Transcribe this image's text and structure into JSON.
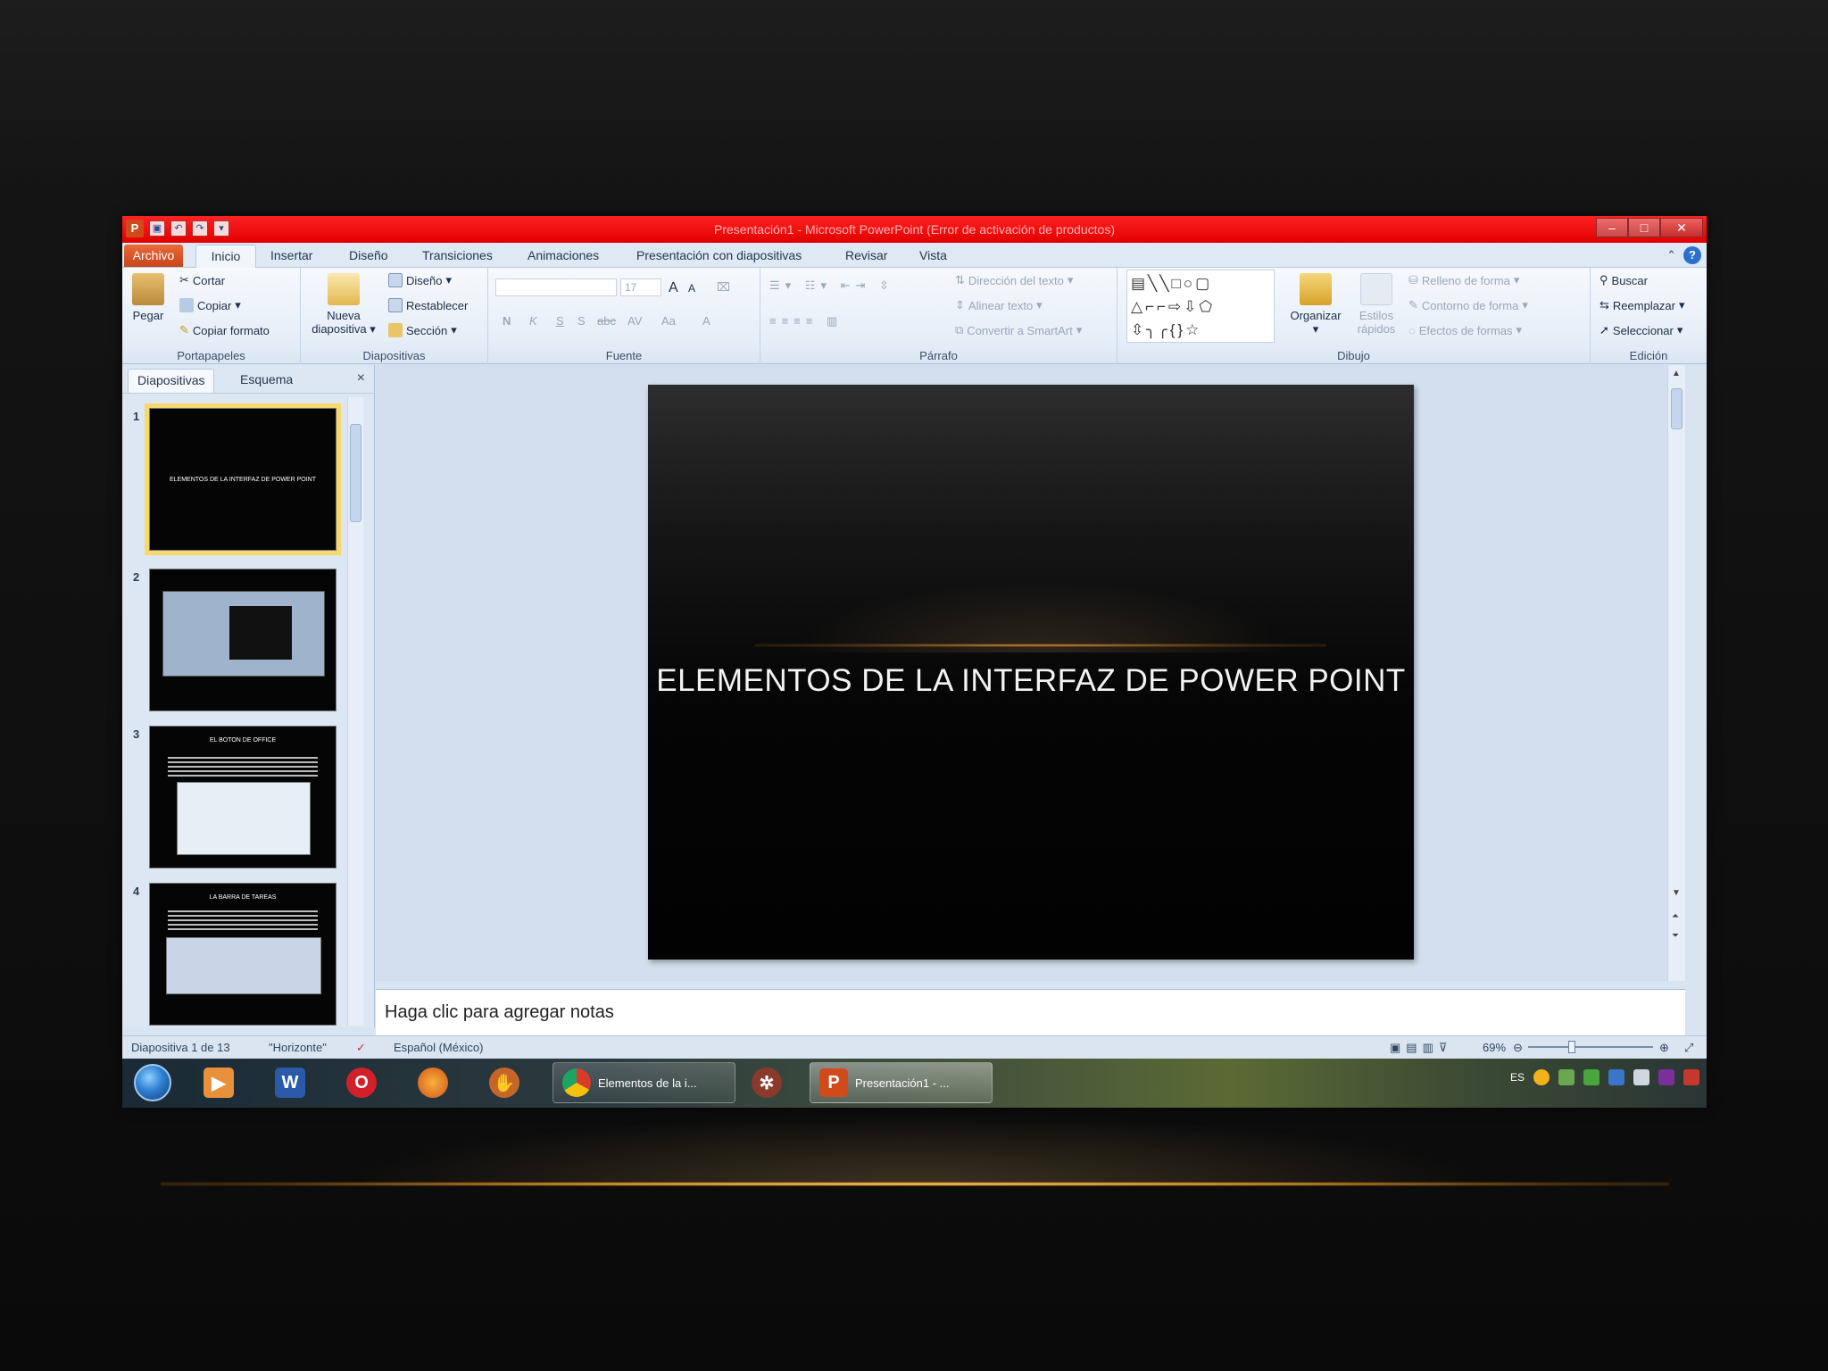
{
  "window": {
    "title": "Presentación1 - Microsoft PowerPoint (Error de activación de productos)",
    "logo": "P",
    "controls": {
      "minimize": "–",
      "maximize": "□",
      "close": "✕"
    }
  },
  "tabs": {
    "file": "Archivo",
    "items": [
      "Inicio",
      "Insertar",
      "Diseño",
      "Transiciones",
      "Animaciones",
      "Presentación con diapositivas",
      "Revisar",
      "Vista"
    ]
  },
  "ribbon": {
    "clipboard": {
      "paste": "Pegar",
      "cut": "Cortar",
      "copy": "Copiar",
      "format_painter": "Copiar formato",
      "label": "Portapapeles"
    },
    "slides": {
      "new_slide_line1": "Nueva",
      "new_slide_line2": "diapositiva",
      "layout": "Diseño",
      "reset": "Restablecer",
      "section": "Sección",
      "label": "Diapositivas"
    },
    "font": {
      "size": "17",
      "bold": "N",
      "italic": "K",
      "underline": "S",
      "strike": "abc",
      "spacing": "AV",
      "case": "Aa",
      "color": "A",
      "grow": "A",
      "shrink": "A",
      "label": "Fuente"
    },
    "paragraph": {
      "text_direction": "Dirección del texto",
      "align_text": "Alinear texto",
      "smartart": "Convertir a SmartArt",
      "label": "Párrafo"
    },
    "drawing": {
      "arrange": "Organizar",
      "quick_styles_line1": "Estilos",
      "quick_styles_line2": "rápidos",
      "shape_fill": "Relleno de forma",
      "shape_outline": "Contorno de forma",
      "shape_effects": "Efectos de formas",
      "label": "Dibujo"
    },
    "editing": {
      "find": "Buscar",
      "replace": "Reemplazar",
      "select": "Seleccionar",
      "label": "Edición"
    }
  },
  "panel": {
    "tab_slides": "Diapositivas",
    "tab_outline": "Esquema",
    "close": "×",
    "thumbs": [
      {
        "num": "1",
        "title": "ELEMENTOS DE LA INTERFAZ DE POWER POINT"
      },
      {
        "num": "2",
        "title": ""
      },
      {
        "num": "3",
        "title": "EL BOTON DE OFFICE"
      },
      {
        "num": "4",
        "title": "LA BARRA DE TAREAS"
      }
    ]
  },
  "slide": {
    "title": "ELEMENTOS DE LA INTERFAZ DE POWER POINT"
  },
  "notes": {
    "placeholder": "Haga clic para agregar notas"
  },
  "status": {
    "slide_count": "Diapositiva 1 de 13",
    "theme": "\"Horizonte\"",
    "language": "Español (México)",
    "zoom": "69%"
  },
  "taskbar": {
    "chrome_task": "Elementos de la i...",
    "ppt_task": "Presentación1 - ...",
    "tray_lang": "ES",
    "word_label": "W",
    "ppt_label": "P"
  },
  "colors": {
    "titlebar": "#e10000",
    "accent_file_tab": "#c8451b",
    "slide_bg": "#050505"
  }
}
